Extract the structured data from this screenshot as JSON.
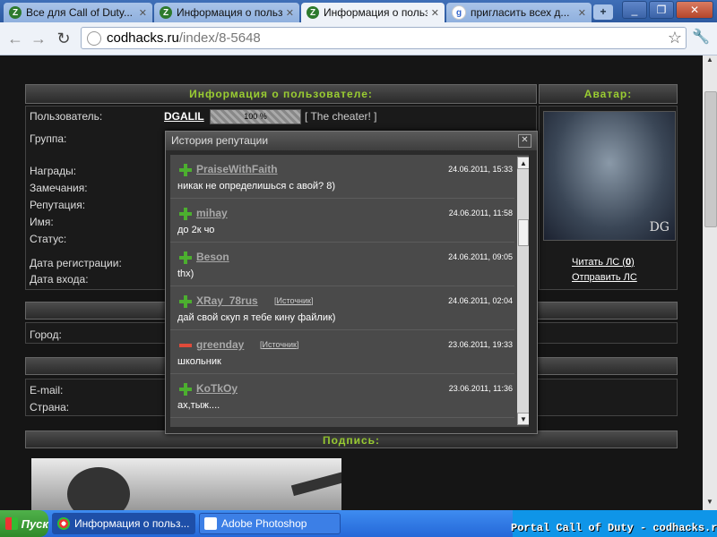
{
  "tabs": [
    {
      "label": "Все для Call of Duty..."
    },
    {
      "label": "Информация о польз..."
    },
    {
      "label": "Информация о польз..."
    },
    {
      "label": "пригласить всех д..."
    }
  ],
  "address": {
    "domain": "codhacks.ru",
    "path": "/index/8-5648"
  },
  "profile": {
    "header": "Информация о пользователе:",
    "avatar_header": "Аватар:",
    "fields": [
      "Пользователь:",
      "Группа:",
      "Награды:",
      "Замечания:",
      "Репутация:",
      "Имя:",
      "Статус:",
      "Дата регистрации:",
      "Дата входа:"
    ],
    "username": "DGALIL",
    "rep_bar": "100 %",
    "tag": "[ The cheater! ]",
    "avatar_text": "DG",
    "read_pm_pre": "Читать ЛС (",
    "read_pm_count": "0",
    "read_pm_post": ")",
    "send_pm": "Отправить ЛС",
    "city": "Город:",
    "email": "E-mail:",
    "country": "Страна:",
    "signature_header": "Подпись:"
  },
  "popup": {
    "title": "История репутации",
    "entries": [
      {
        "sign": "plus",
        "user": "PraiseWithFaith",
        "date": "24.06.2011, 15:33",
        "message": "никак не определишься с авой? 8)",
        "source": ""
      },
      {
        "sign": "plus",
        "user": "mihay",
        "date": "24.06.2011, 11:58",
        "message": "до 2к чо",
        "source": ""
      },
      {
        "sign": "plus",
        "user": "Beson",
        "date": "24.06.2011, 09:05",
        "message": "thx)",
        "source": ""
      },
      {
        "sign": "plus",
        "user": "XRay_78rus",
        "date": "24.06.2011, 02:04",
        "message": "дай свой скуп я тебе кину файлик)",
        "source": "Источник"
      },
      {
        "sign": "minus",
        "user": "greenday",
        "date": "23.06.2011, 19:33",
        "message": "школьник",
        "source": "Источник"
      },
      {
        "sign": "plus",
        "user": "KoTkOy",
        "date": "23.06.2011, 11:36",
        "message": "ах,тыж....",
        "source": ""
      }
    ]
  },
  "taskbar": {
    "start": "Пуск",
    "tasks": [
      "Информация о польз...",
      "Adobe Photoshop"
    ],
    "overlay": "Portal Call of Duty - codhacks.ru"
  }
}
